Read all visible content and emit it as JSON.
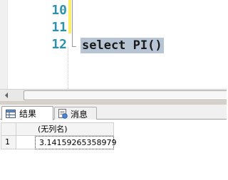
{
  "editor": {
    "lines": [
      {
        "number": "10",
        "code": ""
      },
      {
        "number": "11",
        "code": ""
      },
      {
        "number": "12",
        "code": "select PI()"
      }
    ]
  },
  "tabs": [
    {
      "label": "结果",
      "icon": "grid-icon",
      "active": true
    },
    {
      "label": "消息",
      "icon": "messages-icon",
      "active": false
    }
  ],
  "results_grid": {
    "columns": [
      "(无列名)"
    ],
    "rows": [
      {
        "row_number": "1",
        "values": [
          "3.14159265358979"
        ]
      }
    ]
  },
  "colors": {
    "line_number": "#2b91af",
    "selection": "#b6c4d4",
    "change_bar": "#ffee62"
  }
}
